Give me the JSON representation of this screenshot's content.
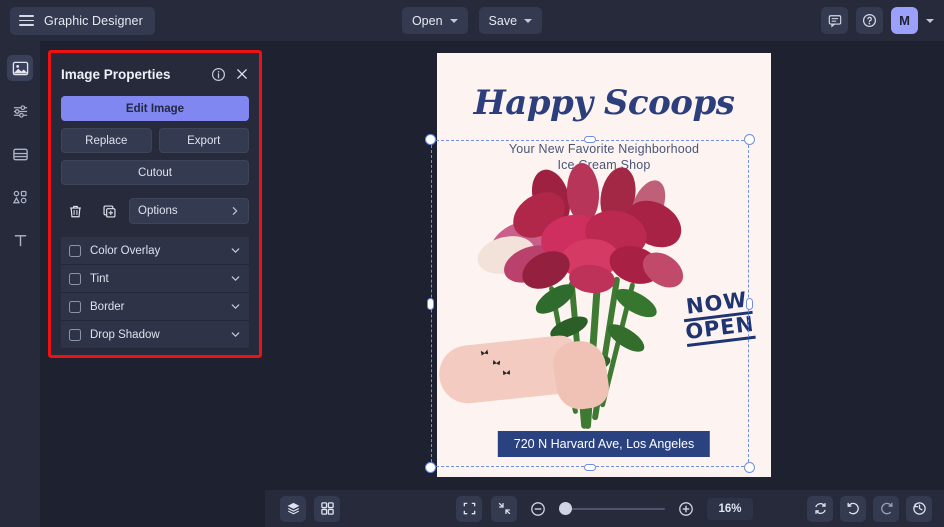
{
  "app": {
    "brand_label": "Graphic Designer",
    "accent_color": "#8187f0",
    "panel_bg": "#262a3b",
    "canvas_bg": "#1e2130",
    "annotation_color": "#ee1111"
  },
  "topbar": {
    "menus": [
      {
        "label": "Open",
        "icon": "chevron-down-icon"
      },
      {
        "label": "Save",
        "icon": "chevron-down-icon"
      }
    ],
    "right": {
      "comment_icon": "comment-icon",
      "help_icon": "help-circle-icon",
      "avatar_initial": "M",
      "avatar_chevron": "chevron-down-icon"
    }
  },
  "rail": {
    "items": [
      {
        "name": "image-tool",
        "icon": "image-icon",
        "active": true
      },
      {
        "name": "adjustments-tool",
        "icon": "sliders-icon",
        "active": false
      },
      {
        "name": "layout-tool",
        "icon": "layout-icon",
        "active": false
      },
      {
        "name": "shapes-tool",
        "icon": "shapes-icon",
        "active": false
      },
      {
        "name": "text-tool",
        "icon": "text-icon",
        "active": false
      }
    ]
  },
  "panel": {
    "title": "Image Properties",
    "info_icon": "info-circle-icon",
    "close_icon": "close-icon",
    "primary_button": "Edit Image",
    "replace_button": "Replace",
    "export_button": "Export",
    "cutout_button": "Cutout",
    "delete_icon": "trash-icon",
    "duplicate_icon": "duplicate-icon",
    "options_label": "Options",
    "options_chevron": "chevron-right-icon",
    "effects": [
      {
        "label": "Color Overlay",
        "checked": false,
        "chevron": "chevron-down-icon"
      },
      {
        "label": "Tint",
        "checked": false,
        "chevron": "chevron-down-icon"
      },
      {
        "label": "Border",
        "checked": false,
        "chevron": "chevron-down-icon"
      },
      {
        "label": "Drop Shadow",
        "checked": false,
        "chevron": "chevron-down-icon"
      }
    ]
  },
  "poster": {
    "title": "Happy Scoops",
    "subtitle": "Your New Favorite Neighborhood\nIce Cream Shop",
    "subtitle_line1": "Your New Favorite Neighborhood",
    "subtitle_line2": "Ice Cream Shop",
    "badge_line1": "NOW",
    "badge_line2": "OPEN",
    "address": "720 N Harvard Ave, Los Angeles",
    "title_color": "#2c3f7c",
    "background_color": "#fdf4f1",
    "banner_color": "#2b4280"
  },
  "bottombar": {
    "layers_icon": "layers-icon",
    "grid_icon": "grid-icon",
    "fit_icon": "fit-screen-icon",
    "collapse_icon": "collapse-icon",
    "zoom_out_icon": "zoom-out-icon",
    "zoom_in_icon": "zoom-in-icon",
    "zoom_level": "16%",
    "reset_icon": "refresh-icon",
    "undo_icon": "undo-icon",
    "redo_icon": "redo-icon",
    "history_icon": "history-icon"
  }
}
